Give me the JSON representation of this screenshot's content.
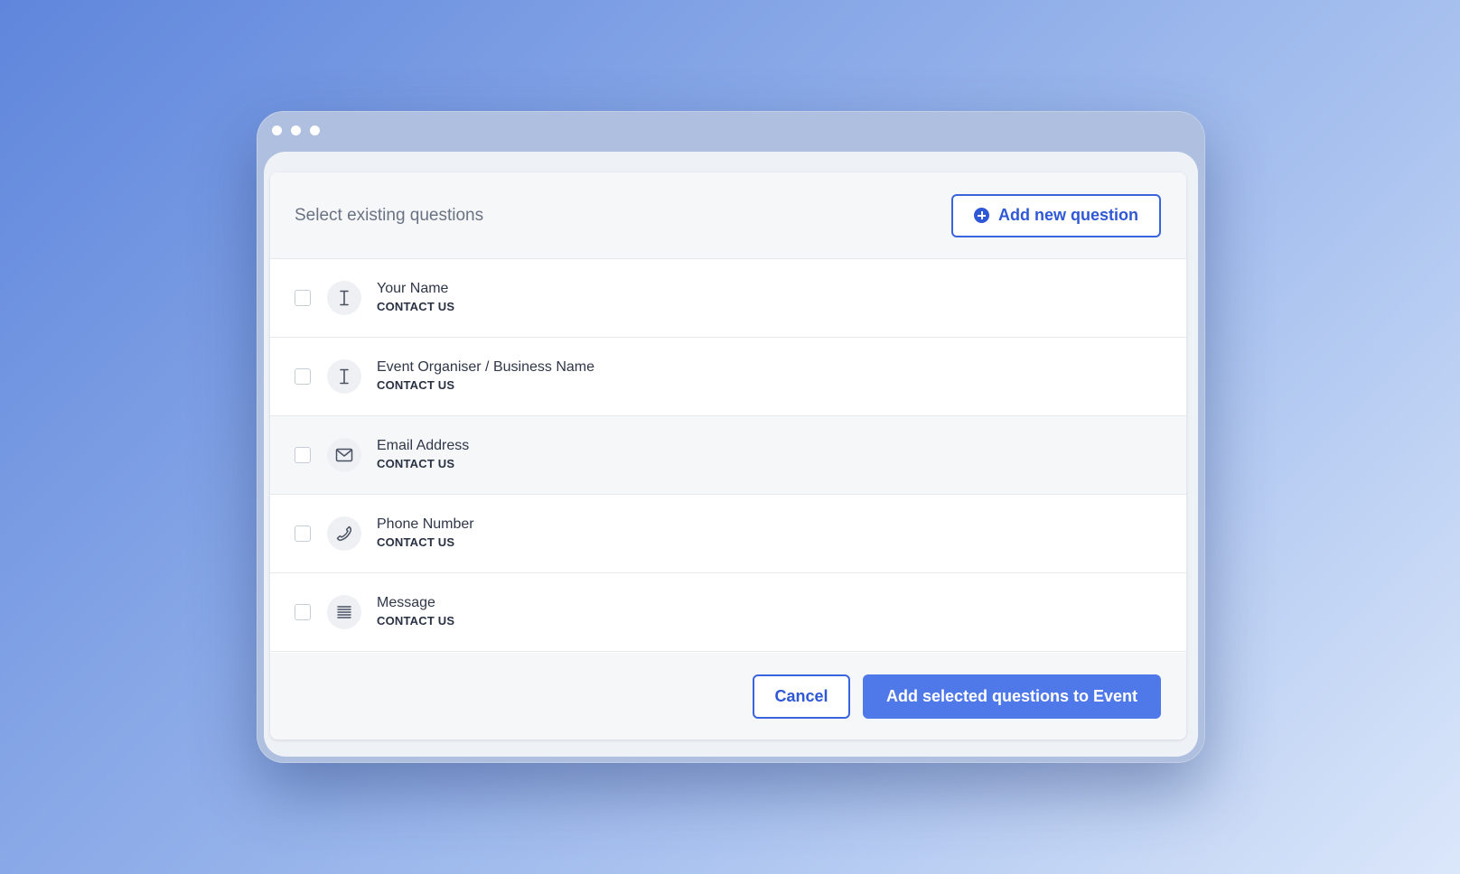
{
  "modal": {
    "title": "Select existing questions",
    "add_new_label": "Add new question",
    "add_new_icon": "plus-circle-icon"
  },
  "questions": [
    {
      "label": "Your Name",
      "group": "CONTACT US",
      "icon": "text-cursor-icon",
      "checked": false
    },
    {
      "label": "Event Organiser / Business Name",
      "group": "CONTACT US",
      "icon": "text-cursor-icon",
      "checked": false
    },
    {
      "label": "Email Address",
      "group": "CONTACT US",
      "icon": "envelope-icon",
      "checked": false
    },
    {
      "label": "Phone Number",
      "group": "CONTACT US",
      "icon": "phone-icon",
      "checked": false
    },
    {
      "label": "Message",
      "group": "CONTACT US",
      "icon": "paragraph-lines-icon",
      "checked": false
    }
  ],
  "footer": {
    "cancel_label": "Cancel",
    "submit_label": "Add selected questions to Event"
  },
  "colors": {
    "accent": "#3c63de",
    "primary_button": "#4f78e9"
  }
}
